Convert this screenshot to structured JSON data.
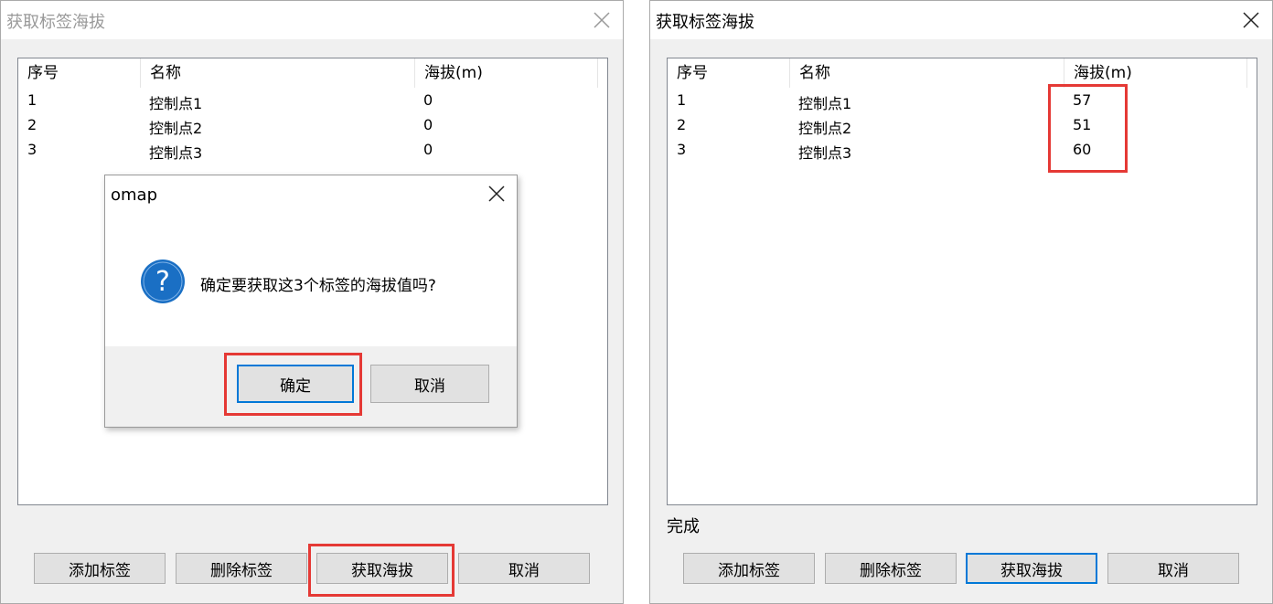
{
  "left_window": {
    "title": "获取标签海拔",
    "columns": [
      "序号",
      "名称",
      "海拔(m)"
    ],
    "rows": [
      {
        "index": "1",
        "name": "控制点1",
        "elevation": "0"
      },
      {
        "index": "2",
        "name": "控制点2",
        "elevation": "0"
      },
      {
        "index": "3",
        "name": "控制点3",
        "elevation": "0"
      }
    ],
    "buttons": {
      "add": "添加标签",
      "delete": "删除标签",
      "fetch": "获取海拔",
      "cancel": "取消"
    }
  },
  "dialog": {
    "title": "omap",
    "message": "确定要获取这3个标签的海拔值吗?",
    "confirm_label": "确定",
    "cancel_label": "取消",
    "icon": "question-icon"
  },
  "right_window": {
    "title": "获取标签海拔",
    "columns": [
      "序号",
      "名称",
      "海拔(m)"
    ],
    "rows": [
      {
        "index": "1",
        "name": "控制点1",
        "elevation": "57"
      },
      {
        "index": "2",
        "name": "控制点2",
        "elevation": "51"
      },
      {
        "index": "3",
        "name": "控制点3",
        "elevation": "60"
      }
    ],
    "status": "完成",
    "buttons": {
      "add": "添加标签",
      "delete": "删除标签",
      "fetch": "获取海拔",
      "cancel": "取消"
    }
  },
  "colors": {
    "highlight": "#e53935",
    "accent": "#0078d7",
    "question_icon": "#1a6fc4"
  }
}
